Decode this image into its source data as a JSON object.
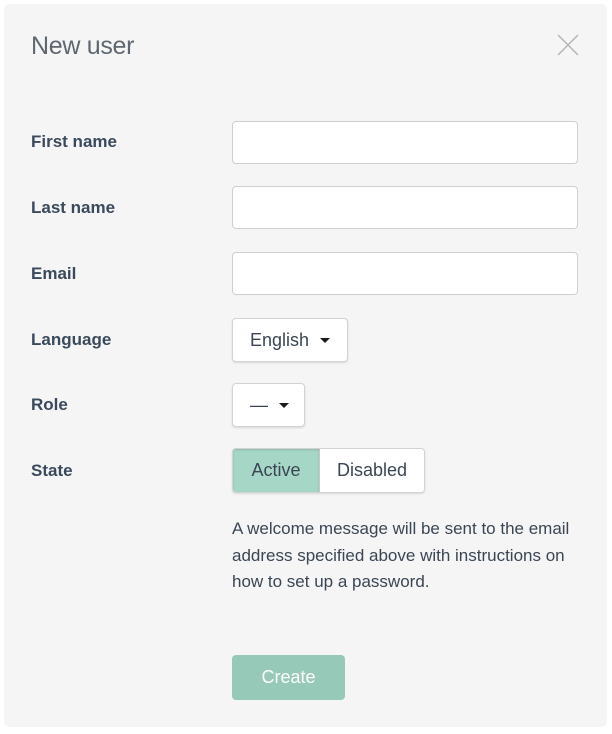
{
  "dialog": {
    "title": "New user",
    "close_icon": "close-x-icon"
  },
  "form": {
    "first_name": {
      "label": "First name",
      "value": "",
      "placeholder": ""
    },
    "last_name": {
      "label": "Last name",
      "value": "",
      "placeholder": ""
    },
    "email": {
      "label": "Email",
      "value": "",
      "placeholder": ""
    },
    "language": {
      "label": "Language",
      "selected": "English",
      "icon": "caret-down-icon"
    },
    "role": {
      "label": "Role",
      "selected": "—",
      "icon": "caret-down-icon"
    },
    "state": {
      "label": "State",
      "options": [
        "Active",
        "Disabled"
      ],
      "selected": "Active"
    },
    "help_text": "A welcome message will be sent to the email address specified above with instructions on how to set up a password.",
    "submit_label": "Create"
  },
  "colors": {
    "dialog_background": "#f5f5f5",
    "accent": "#96c9b8",
    "active_toggle": "#a6d7c6",
    "label_text": "#3a4a5c",
    "title_text": "#5f6770"
  }
}
